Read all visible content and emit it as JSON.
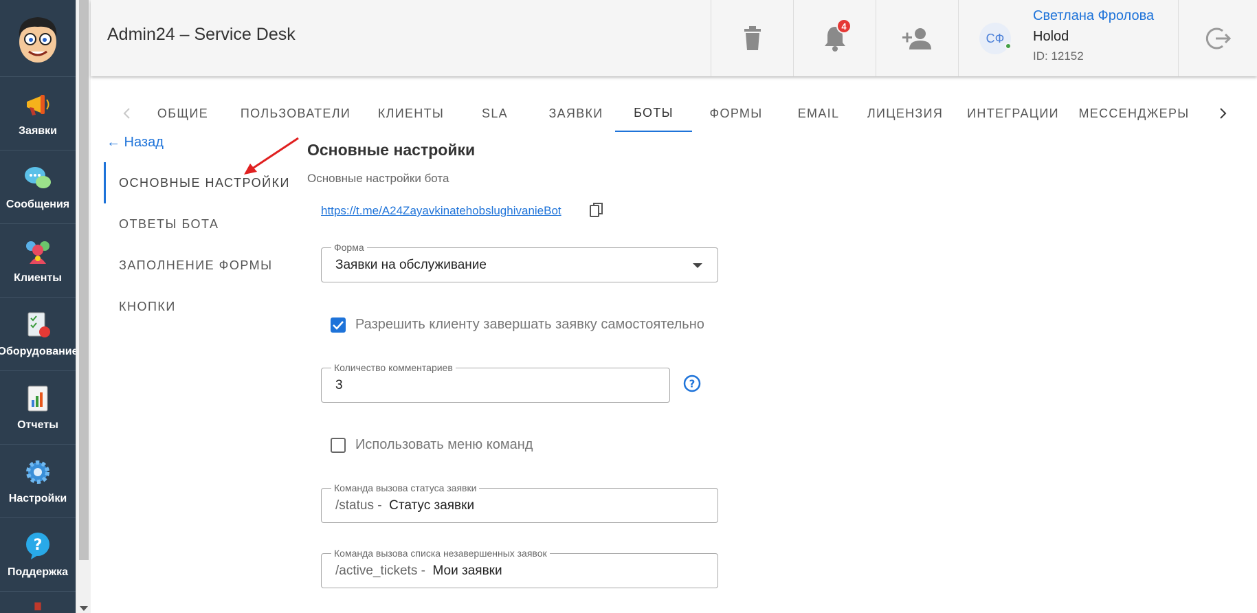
{
  "sidebar": {
    "items": [
      {
        "label": "Заявки",
        "icon": "megaphone-icon"
      },
      {
        "label": "Сообщения",
        "icon": "chat-bubbles-icon"
      },
      {
        "label": "Клиенты",
        "icon": "users-icon"
      },
      {
        "label": "Оборудование",
        "icon": "equipment-checklist-icon"
      },
      {
        "label": "Отчеты",
        "icon": "report-chart-icon"
      },
      {
        "label": "Настройки",
        "icon": "gear-icon"
      },
      {
        "label": "Поддержка",
        "icon": "help-bubble-icon"
      }
    ]
  },
  "header": {
    "title": "Admin24 – Service Desk",
    "notifications_count": "4",
    "user": {
      "initials": "СФ",
      "name": "Светлана Фролова",
      "org": "Holod",
      "id": "ID: 12152"
    }
  },
  "tabs": {
    "items": [
      "ОБЩИЕ",
      "ПОЛЬЗОВАТЕЛИ",
      "КЛИЕНТЫ",
      "SLA",
      "ЗАЯВКИ",
      "БОТЫ",
      "ФОРМЫ",
      "EMAIL",
      "ЛИЦЕНЗИЯ",
      "ИНТЕГРАЦИИ",
      "МЕССЕНДЖЕРЫ"
    ],
    "active": "БОТЫ"
  },
  "back_label": "← Назад",
  "subnav": {
    "items": [
      "ОСНОВНЫЕ НАСТРОЙКИ",
      "ОТВЕТЫ БОТА",
      "ЗАПОЛНЕНИЕ ФОРМЫ",
      "КНОПКИ"
    ],
    "active": "ОСНОВНЫЕ НАСТРОЙКИ"
  },
  "content": {
    "title": "Основные настройки",
    "subtitle": "Основные настройки бота",
    "bot_link": "https://t.me/A24ZayavkinatehobslughivanieBot",
    "form_field": {
      "legend": "Форма",
      "value": "Заявки на обслуживание"
    },
    "allow_close": {
      "label": "Разрешить клиенту завершать заявку самостоятельно",
      "checked": true
    },
    "comments_field": {
      "legend": "Количество комментариев",
      "value": "3"
    },
    "use_menu": {
      "label": "Использовать меню команд",
      "checked": false
    },
    "status_cmd": {
      "legend": "Команда вызова статуса заявки",
      "prefix": "/status -",
      "value": "Статус заявки"
    },
    "active_cmd": {
      "legend": "Команда вызова списка незавершенных заявок",
      "prefix": "/active_tickets -",
      "value": "Мои заявки"
    }
  },
  "colors": {
    "accent": "#1e73d9",
    "sidebar": "#2d3e4f",
    "badge": "#e53935",
    "annotation_arrow": "#e02020"
  }
}
